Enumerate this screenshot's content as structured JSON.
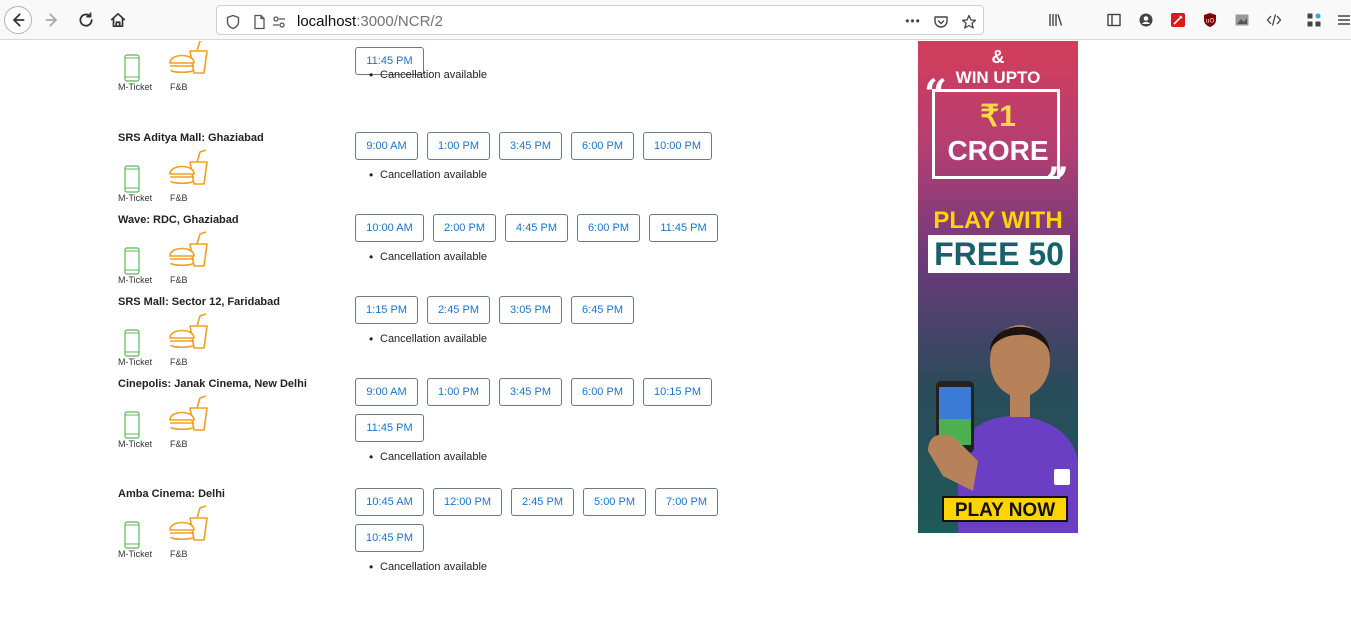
{
  "browser": {
    "url_host": "localhost",
    "url_path": ":3000/NCR/2",
    "more_label": "•••"
  },
  "features": {
    "mticket_label": "M-Ticket",
    "fnb_label": "F&B"
  },
  "venues": [
    {
      "name": "",
      "times": [
        "11:45 PM"
      ],
      "top_row_partial": true,
      "cancellation": "Cancellation available"
    },
    {
      "name": "SRS Aditya Mall: Ghaziabad",
      "times": [
        "9:00 AM",
        "1:00 PM",
        "3:45 PM",
        "6:00 PM",
        "10:00 PM"
      ],
      "cancellation": "Cancellation available"
    },
    {
      "name": "Wave: RDC, Ghaziabad",
      "times": [
        "10:00 AM",
        "2:00 PM",
        "4:45 PM",
        "6:00 PM",
        "11:45 PM"
      ],
      "cancellation": "Cancellation available"
    },
    {
      "name": "SRS Mall: Sector 12, Faridabad",
      "times": [
        "1:15 PM",
        "2:45 PM",
        "3:05 PM",
        "6:45 PM"
      ],
      "cancellation": "Cancellation available"
    },
    {
      "name": "Cinepolis: Janak Cinema, New Delhi",
      "times": [
        "9:00 AM",
        "1:00 PM",
        "3:45 PM",
        "6:00 PM",
        "10:15 PM",
        "11:45 PM"
      ],
      "cancellation": "Cancellation available"
    },
    {
      "name": "Amba Cinema: Delhi",
      "times": [
        "10:45 AM",
        "12:00 PM",
        "2:45 PM",
        "5:00 PM",
        "7:00 PM",
        "10:45 PM"
      ],
      "cancellation": "Cancellation available"
    }
  ],
  "ad": {
    "amp": "&",
    "win": "WIN UPTO",
    "amount": "₹1",
    "crore": "CRORE",
    "play_with": "PLAY WITH",
    "free": "FREE 50",
    "cta": "PLAY NOW"
  },
  "colors": {
    "time_text": "#1a73c8",
    "fnb_icon": "#f0a020",
    "mticket_icon": "#5cb85c"
  }
}
